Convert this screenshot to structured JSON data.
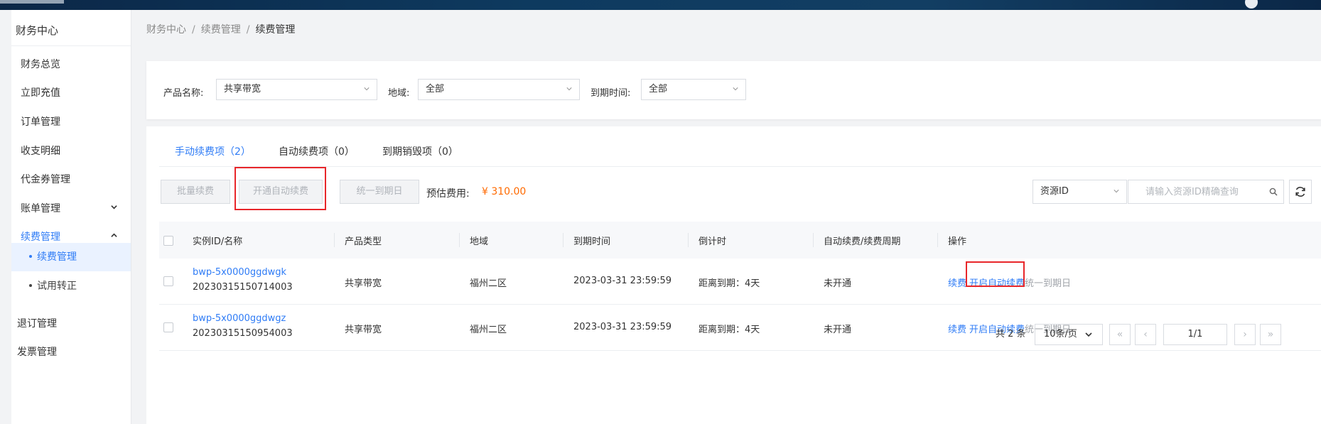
{
  "sidebar": {
    "title": "财务中心",
    "items": [
      {
        "label": "财务总览"
      },
      {
        "label": "立即充值"
      },
      {
        "label": "订单管理"
      },
      {
        "label": "收支明细"
      },
      {
        "label": "代金券管理"
      },
      {
        "label": "账单管理"
      },
      {
        "label": "续费管理"
      },
      {
        "label": "退订管理"
      },
      {
        "label": "发票管理"
      }
    ],
    "sub_items": [
      {
        "label": "续费管理"
      },
      {
        "label": "试用转正"
      }
    ]
  },
  "breadcrumb": {
    "level1": "财务中心",
    "level2": "续费管理",
    "current": "续费管理",
    "separator": "/"
  },
  "filters": {
    "product_label": "产品名称:",
    "product_value": "共享带宽",
    "region_label": "地域:",
    "region_value": "全部",
    "expiry_label": "到期时间:",
    "expiry_value": "全部"
  },
  "tabs": [
    {
      "label": "手动续费项（2）"
    },
    {
      "label": "自动续费项（0）"
    },
    {
      "label": "到期销毁项（0）"
    }
  ],
  "toolbar": {
    "batch_renew": "批量续费",
    "enable_auto": "开通自动续费",
    "unify_date": "统一到期日",
    "fee_label": "预估费用:",
    "fee_value": "¥ 310.00",
    "resource_select": "资源ID",
    "search_placeholder": "请输入资源ID精确查询"
  },
  "table": {
    "headers": [
      "实例ID/名称",
      "产品类型",
      "地域",
      "到期时间",
      "倒计时",
      "自动续费/续费周期",
      "操作"
    ],
    "rows": [
      {
        "id": "bwp-5x0000ggdwgk",
        "name": "20230315150714003",
        "type": "共享带宽",
        "region": "福州二区",
        "expiry": "2023-03-31 23:59:59",
        "countdown": "距离到期：4天",
        "auto_renew": "未开通",
        "action_renew": "续费",
        "action_auto": "开启自动续费",
        "action_unify": "统一到期日"
      },
      {
        "id": "bwp-5x0000ggdwgz",
        "name": "20230315150954003",
        "type": "共享带宽",
        "region": "福州二区",
        "expiry": "2023-03-31 23:59:59",
        "countdown": "距离到期：4天",
        "auto_renew": "未开通",
        "action_renew": "续费",
        "action_auto": "开启自动续费",
        "action_unify": "统一到期日"
      }
    ]
  },
  "pagination": {
    "total": "共 2 条",
    "page_size": "10条/页",
    "page_indicator": "1/1"
  },
  "colors": {
    "accent": "#2f7cf6",
    "price": "#ff6a00",
    "highlight_box": "#e8262a",
    "topbar": "#0e3a5f"
  },
  "icons": {
    "collapse": "chevron-down-icon",
    "expand": "chevron-up-icon",
    "search": "search-icon",
    "refresh": "refresh-icon"
  }
}
